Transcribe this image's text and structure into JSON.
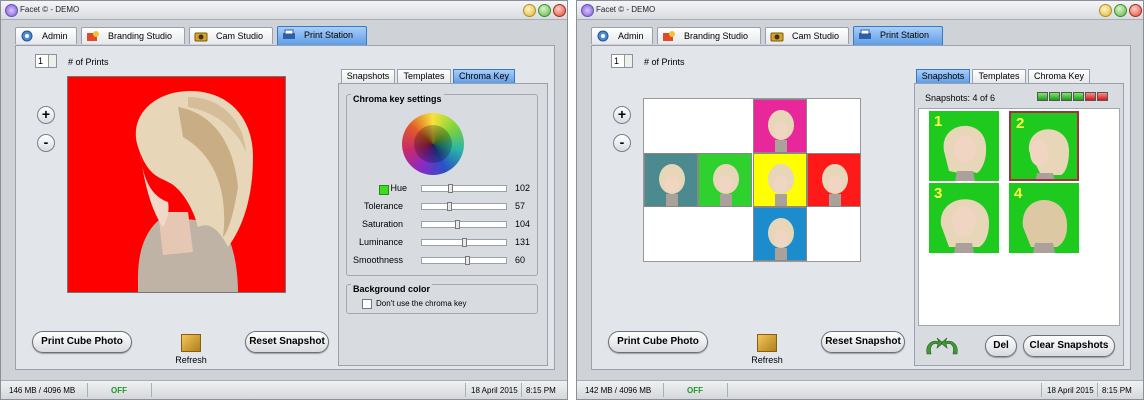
{
  "windows": [
    {
      "title": "Facet © - DEMO",
      "tabs": [
        "Admin",
        "Branding Studio",
        "Cam Studio",
        "Print Station"
      ],
      "active_tab": "Print Station",
      "prints_count": "1",
      "prints_label": "# of Prints",
      "zoom_in": "+",
      "zoom_out": "-",
      "subtabs": [
        "Snapshots",
        "Templates",
        "Chroma Key"
      ],
      "active_subtab": "Chroma Key",
      "chroma": {
        "group_title": "Chroma key settings",
        "rows": [
          {
            "label": "Hue",
            "value": "102",
            "fraction": 0.33
          },
          {
            "label": "Tolerance",
            "value": "57",
            "fraction": 0.32
          },
          {
            "label": "Saturation",
            "value": "104",
            "fraction": 0.42
          },
          {
            "label": "Luminance",
            "value": "131",
            "fraction": 0.51
          },
          {
            "label": "Smoothness",
            "value": "60",
            "fraction": 0.55
          }
        ],
        "hue_swatch_color": "#3ddc1c",
        "background_title": "Background color",
        "checkbox_label": "Don't use the chroma key"
      },
      "buttons": {
        "print": "Print Cube Photo",
        "refresh": "Refresh",
        "reset": "Reset Snapshot"
      },
      "photo_bg_color": "#ff0000",
      "status": {
        "memory": "146 MB / 4096 MB",
        "state": "OFF",
        "date": "18 April 2015",
        "time": "8:15 PM"
      }
    },
    {
      "title": "Facet © - DEMO",
      "tabs": [
        "Admin",
        "Branding Studio",
        "Cam Studio",
        "Print Station"
      ],
      "active_tab": "Print Station",
      "prints_count": "1",
      "prints_label": "# of Prints",
      "zoom_in": "+",
      "zoom_out": "-",
      "subtabs": [
        "Snapshots",
        "Templates",
        "Chroma Key"
      ],
      "active_subtab": "Snapshots",
      "snapshots": {
        "count_label": "Snapshots: 4 of 6",
        "numbers": [
          "1",
          "2",
          "3",
          "4"
        ],
        "indicators": [
          "green",
          "green",
          "green",
          "green",
          "red",
          "red"
        ]
      },
      "cube_faces": [
        {
          "pos": "top",
          "color": "#e8289a"
        },
        {
          "pos": "left",
          "color": "#4b8b8f"
        },
        {
          "pos": "center-left",
          "color": "#2fd12f"
        },
        {
          "pos": "center",
          "color": "#ffff00"
        },
        {
          "pos": "right",
          "color": "#ff1a1a"
        },
        {
          "pos": "bottom",
          "color": "#1c8ccc"
        }
      ],
      "buttons": {
        "print": "Print Cube Photo",
        "refresh": "Refresh",
        "reset": "Reset Snapshot",
        "del": "Del",
        "clear": "Clear Snapshots"
      },
      "status": {
        "memory": "142 MB / 4096 MB",
        "state": "OFF",
        "date": "18 April 2015",
        "time": "8:15 PM"
      }
    }
  ]
}
